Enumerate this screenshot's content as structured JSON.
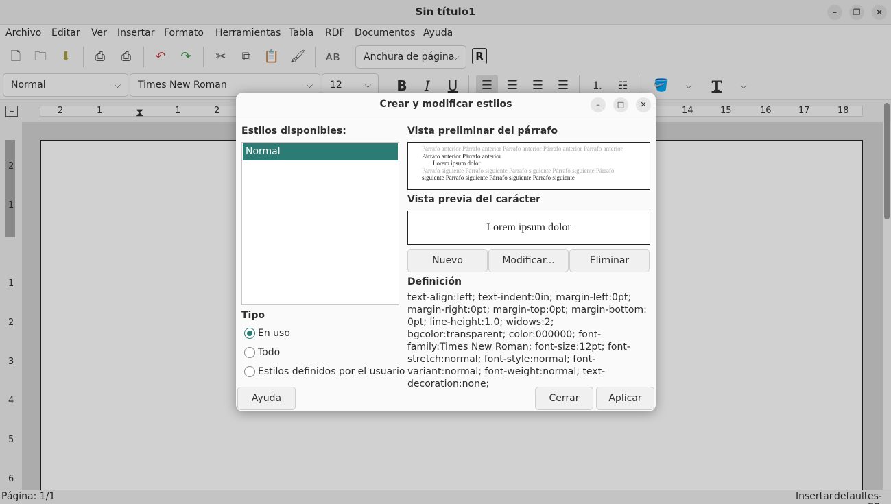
{
  "window": {
    "title": "Sin título1"
  },
  "menu": [
    "Archivo",
    "Editar",
    "Ver",
    "Insertar",
    "Formato",
    "Herramientas",
    "Tabla",
    "RDF",
    "Documentos",
    "Ayuda"
  ],
  "toolbar": {
    "zoom_combo": "Anchura de página",
    "para_style": "Normal",
    "font_name": "Times New Roman",
    "font_size": "12",
    "bold": "B",
    "italic": "I",
    "underline": "U",
    "text_t": "T"
  },
  "ruler": {
    "h_labels": [
      "2",
      "1",
      "1",
      "2",
      "14",
      "15",
      "16",
      "17",
      "18"
    ],
    "v_labels": [
      "2",
      "1",
      "1",
      "2",
      "3",
      "4",
      "5",
      "6"
    ]
  },
  "status": {
    "page": "Página: 1/1",
    "mode": "Insertar",
    "style": "default",
    "lang": "es-ES"
  },
  "dialog": {
    "title": "Crear y modificar estilos",
    "available_label": "Estilos disponibles:",
    "styles": [
      "Normal"
    ],
    "type_label": "Tipo",
    "types": [
      "En uso",
      "Todo",
      "Estilos definidos por el usuario"
    ],
    "selected_type": "En uso",
    "para_preview_label": "Vista preliminar del párrafo",
    "para_prev_1": "Párrafo anterior Párrafo anterior Párrafo anterior Párrafo anterior Párrafo anterior",
    "para_prev_2": "Párrafo anterior Párrafo anterior",
    "para_cur": "Lorem ipsum dolor",
    "para_next_1": "Párrafo siguiente Párrafo siguiente Párrafo siguiente Párrafo siguiente Párrafo",
    "para_next_2": "siguiente Párrafo siguiente Párrafo siguiente Párrafo siguiente",
    "char_preview_label": "Vista previa del carácter",
    "char_preview": "Lorem ipsum dolor",
    "btn_new": "Nuevo",
    "btn_modify": "Modificar...",
    "btn_delete": "Eliminar",
    "definition_label": "Definición",
    "definition": "text-align:left; text-indent:0in; margin-left:0pt; margin-right:0pt; margin-top:0pt; margin-bottom: 0pt; line-height:1.0; widows:2; bgcolor:transparent; color:000000; font-family:Times New Roman; font-size:12pt; font-stretch:normal; font-style:normal; font-variant:normal; font-weight:normal; text-decoration:none;",
    "btn_help": "Ayuda",
    "btn_close": "Cerrar",
    "btn_apply": "Aplicar"
  },
  "colors": {
    "accent": "#2c7b74"
  }
}
